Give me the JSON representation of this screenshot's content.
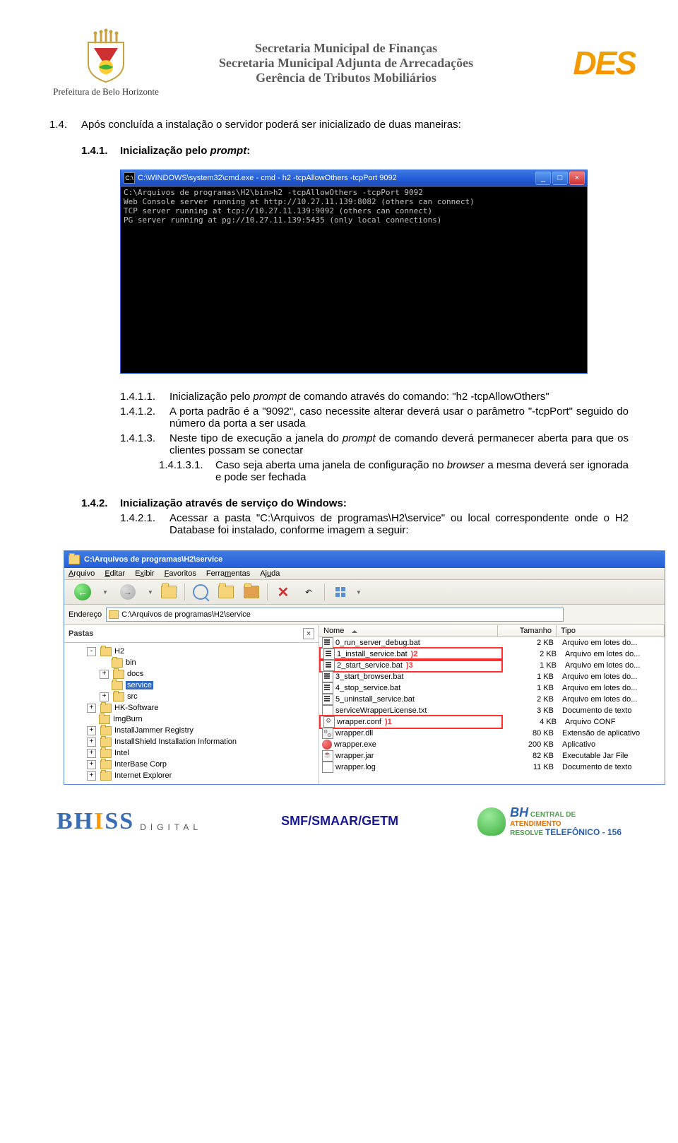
{
  "header": {
    "pbh": "Prefeitura de Belo Horizonte",
    "line1": "Secretaria Municipal de Finanças",
    "line2": "Secretaria Municipal Adjunta de Arrecadações",
    "line3": "Gerência de Tributos Mobiliários",
    "des": "DES"
  },
  "body": {
    "s14": {
      "num": "1.4.",
      "txt": "Após concluída a instalação o servidor poderá ser inicializado de duas maneiras:"
    },
    "s141": {
      "num": "1.4.1.",
      "txt_a": "Inicialização pelo ",
      "txt_b": "prompt",
      "txt_c": ":"
    },
    "s1411": {
      "num": "1.4.1.1.",
      "txt_a": "Inicialização pelo ",
      "txt_b": "prompt",
      "txt_c": " de comando através do comando: \"h2 -tcpAllowOthers\""
    },
    "s1412": {
      "num": "1.4.1.2.",
      "txt": "A porta padrão é a \"9092\", caso necessite alterar deverá usar o parâmetro \"-tcpPort\" seguido do número da porta a ser usada"
    },
    "s1413": {
      "num": "1.4.1.3.",
      "txt_a": "Neste tipo de execução a janela do ",
      "txt_b": "prompt",
      "txt_c": " de comando deverá permanecer aberta para que os clientes possam se conectar"
    },
    "s14131": {
      "num": "1.4.1.3.1.",
      "txt_a": "Caso seja aberta uma janela de configuração no ",
      "txt_b": "browser",
      "txt_c": " a mesma deverá ser ignorada e pode ser fechada"
    },
    "s142": {
      "num": "1.4.2.",
      "txt": "Inicialização através de serviço do Windows:"
    },
    "s1421": {
      "num": "1.4.2.1.",
      "txt": "Acessar a pasta \"C:\\Arquivos de programas\\H2\\service\" ou local correspondente onde o H2 Database foi instalado, conforme imagem a seguir:"
    }
  },
  "cmd": {
    "title": "C:\\WINDOWS\\system32\\cmd.exe - cmd  - h2 -tcpAllowOthers -tcpPort 9092",
    "lines": "C:\\Arquivos de programas\\H2\\bin>h2 -tcpAllowOthers -tcpPort 9092\nWeb Console server running at http://10.27.11.139:8082 (others can connect)\nTCP server running at tcp://10.27.11.139:9092 (others can connect)\nPG server running at pg://10.27.11.139:5435 (only local connections)"
  },
  "explorer": {
    "title": "C:\\Arquivos de programas\\H2\\service",
    "menu": {
      "arquivo": "Arquivo",
      "editar": "Editar",
      "exibir": "Exibir",
      "favoritos": "Favoritos",
      "ferramentas": "Ferramentas",
      "ajuda": "Ajuda"
    },
    "addr_label": "Endereço",
    "addr_value": "C:\\Arquivos de programas\\H2\\service",
    "left_head": "Pastas",
    "tree": [
      {
        "indent": 0,
        "toggle": "-",
        "label": "H2"
      },
      {
        "indent": 1,
        "toggle": "",
        "label": "bin"
      },
      {
        "indent": 1,
        "toggle": "+",
        "label": "docs"
      },
      {
        "indent": 1,
        "toggle": "",
        "label": "service",
        "sel": true
      },
      {
        "indent": 1,
        "toggle": "+",
        "label": "src"
      },
      {
        "indent": 0,
        "toggle": "+",
        "label": "HK-Software"
      },
      {
        "indent": 0,
        "toggle": "",
        "label": "ImgBurn"
      },
      {
        "indent": 0,
        "toggle": "+",
        "label": "InstallJammer Registry"
      },
      {
        "indent": 0,
        "toggle": "+",
        "label": "InstallShield Installation Information"
      },
      {
        "indent": 0,
        "toggle": "+",
        "label": "Intel"
      },
      {
        "indent": 0,
        "toggle": "+",
        "label": "InterBase Corp"
      },
      {
        "indent": 0,
        "toggle": "+",
        "label": "Internet Explorer"
      }
    ],
    "cols": {
      "nome": "Nome",
      "tamanho": "Tamanho",
      "tipo": "Tipo"
    },
    "files": [
      {
        "ico": "bat",
        "name": "0_run_server_debug.bat",
        "size": "2 KB",
        "type": "Arquivo em lotes do...",
        "hl": 0
      },
      {
        "ico": "bat",
        "name": "1_install_service.bat",
        "size": "2 KB",
        "type": "Arquivo em lotes do...",
        "hl": 2
      },
      {
        "ico": "bat",
        "name": "2_start_service.bat",
        "size": "1 KB",
        "type": "Arquivo em lotes do...",
        "hl": 3
      },
      {
        "ico": "bat",
        "name": "3_start_browser.bat",
        "size": "1 KB",
        "type": "Arquivo em lotes do...",
        "hl": 0
      },
      {
        "ico": "bat",
        "name": "4_stop_service.bat",
        "size": "1 KB",
        "type": "Arquivo em lotes do...",
        "hl": 0
      },
      {
        "ico": "bat",
        "name": "5_uninstall_service.bat",
        "size": "2 KB",
        "type": "Arquivo em lotes do...",
        "hl": 0
      },
      {
        "ico": "txt",
        "name": "serviceWrapperLicense.txt",
        "size": "3 KB",
        "type": "Documento de texto",
        "hl": 0
      },
      {
        "ico": "conf",
        "name": "wrapper.conf",
        "size": "4 KB",
        "type": "Arquivo CONF",
        "hl": 1
      },
      {
        "ico": "dll",
        "name": "wrapper.dll",
        "size": "80 KB",
        "type": "Extensão de aplicativo",
        "hl": 0
      },
      {
        "ico": "exe",
        "name": "wrapper.exe",
        "size": "200 KB",
        "type": "Aplicativo",
        "hl": 0
      },
      {
        "ico": "jar",
        "name": "wrapper.jar",
        "size": "82 KB",
        "type": "Executable Jar File",
        "hl": 0
      },
      {
        "ico": "txt",
        "name": "wrapper.log",
        "size": "11 KB",
        "type": "Documento de texto",
        "hl": 0
      }
    ]
  },
  "footer": {
    "bhiss": "BHISS",
    "digital": "DIGITAL",
    "smf": "SMF/SMAAR/GETM",
    "central1": "BH",
    "central2": "CENTRAL DE",
    "central3": "ATENDIMENTO",
    "central4": "RESOLVE",
    "central5": "TELEFÔNICO - 156"
  }
}
